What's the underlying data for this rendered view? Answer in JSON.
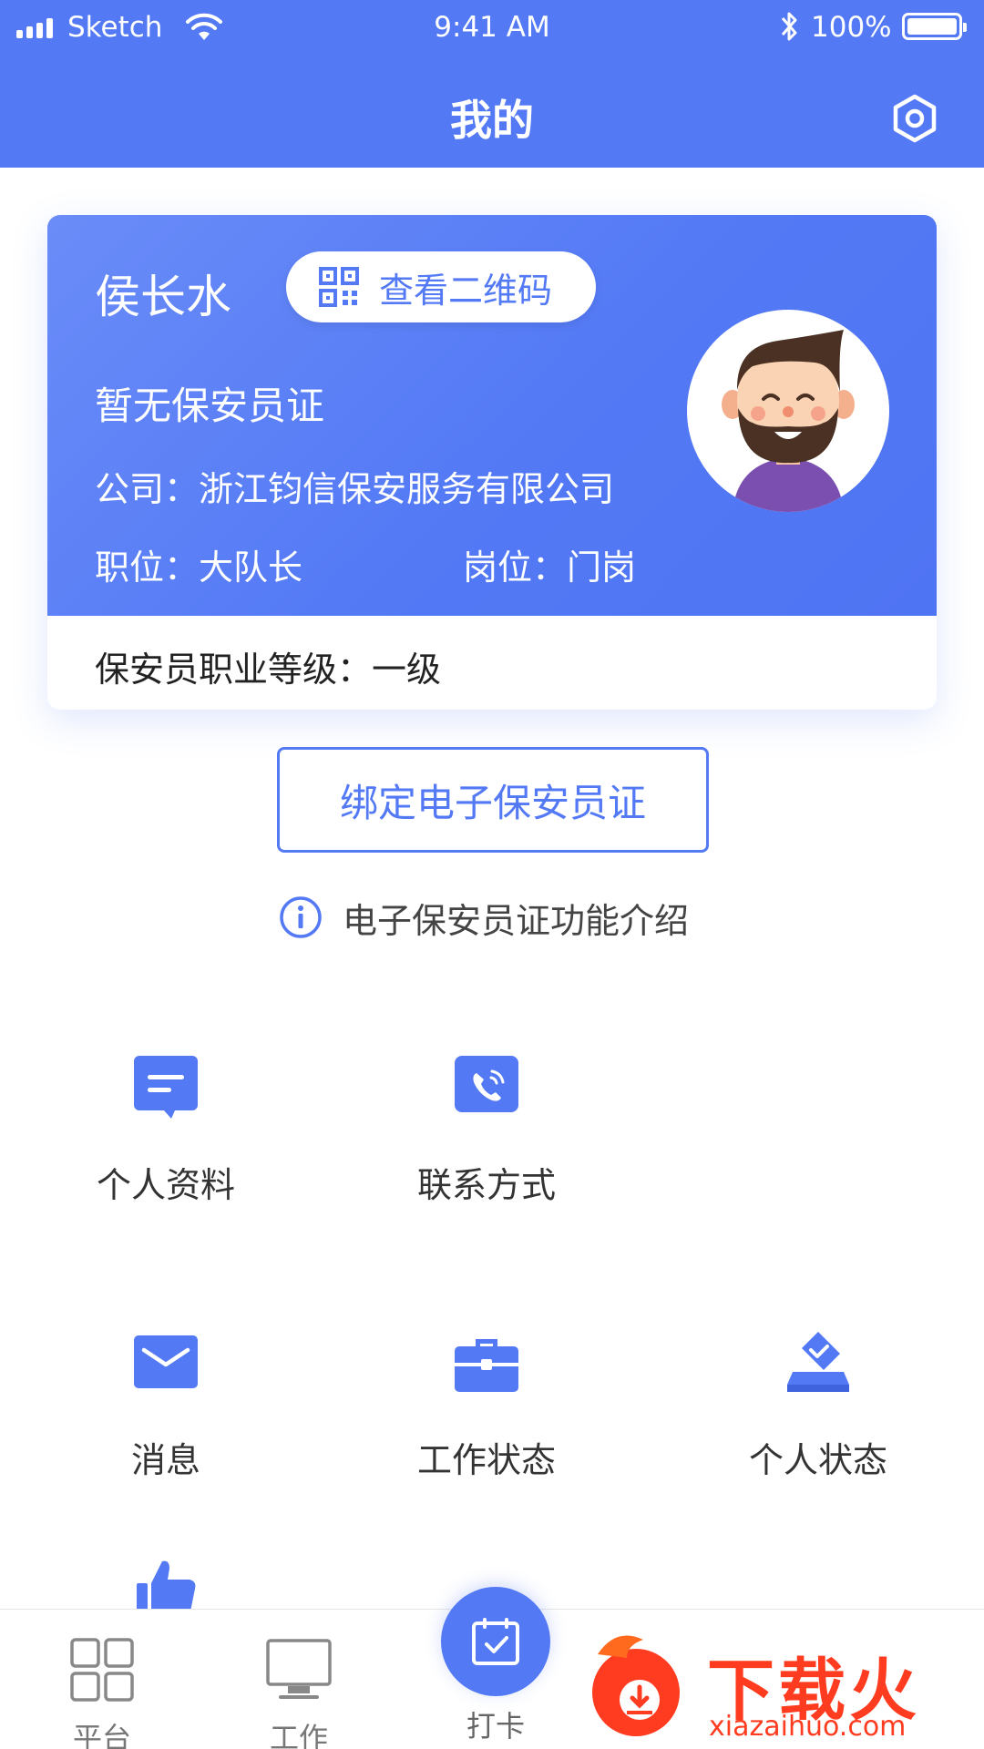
{
  "status_bar": {
    "carrier": "Sketch",
    "time": "9:41 AM",
    "battery": "100%"
  },
  "header": {
    "title": "我的"
  },
  "profile": {
    "name": "侯长水",
    "qr_label": "查看二维码",
    "cert_status": "暂无保安员证",
    "company": "公司：浙江钧信保安服务有限公司",
    "position": "职位：大队长",
    "post": "岗位：门岗",
    "level": "保安员职业等级：一级"
  },
  "bind_button": "绑定电子保安员证",
  "intro_link": "电子保安员证功能介绍",
  "menu": [
    {
      "label": "个人资料",
      "icon": "profile-card-icon"
    },
    {
      "label": "联系方式",
      "icon": "phone-icon"
    },
    {
      "label": "消息",
      "icon": "message-icon"
    },
    {
      "label": "工作状态",
      "icon": "briefcase-icon"
    },
    {
      "label": "个人状态",
      "icon": "ballot-check-icon"
    },
    {
      "label": "",
      "icon": "thumbs-up-icon"
    }
  ],
  "bottom_nav": [
    {
      "label": "平台",
      "icon": "grid-icon"
    },
    {
      "label": "工作",
      "icon": "monitor-icon"
    },
    {
      "label": "打卡",
      "icon": "calendar-check-icon"
    }
  ],
  "watermark": {
    "brand": "下载火",
    "url": "xiazaihuo.com"
  },
  "colors": {
    "primary": "#5379f5",
    "text": "#333333",
    "watermark": "#ff3c1f"
  }
}
